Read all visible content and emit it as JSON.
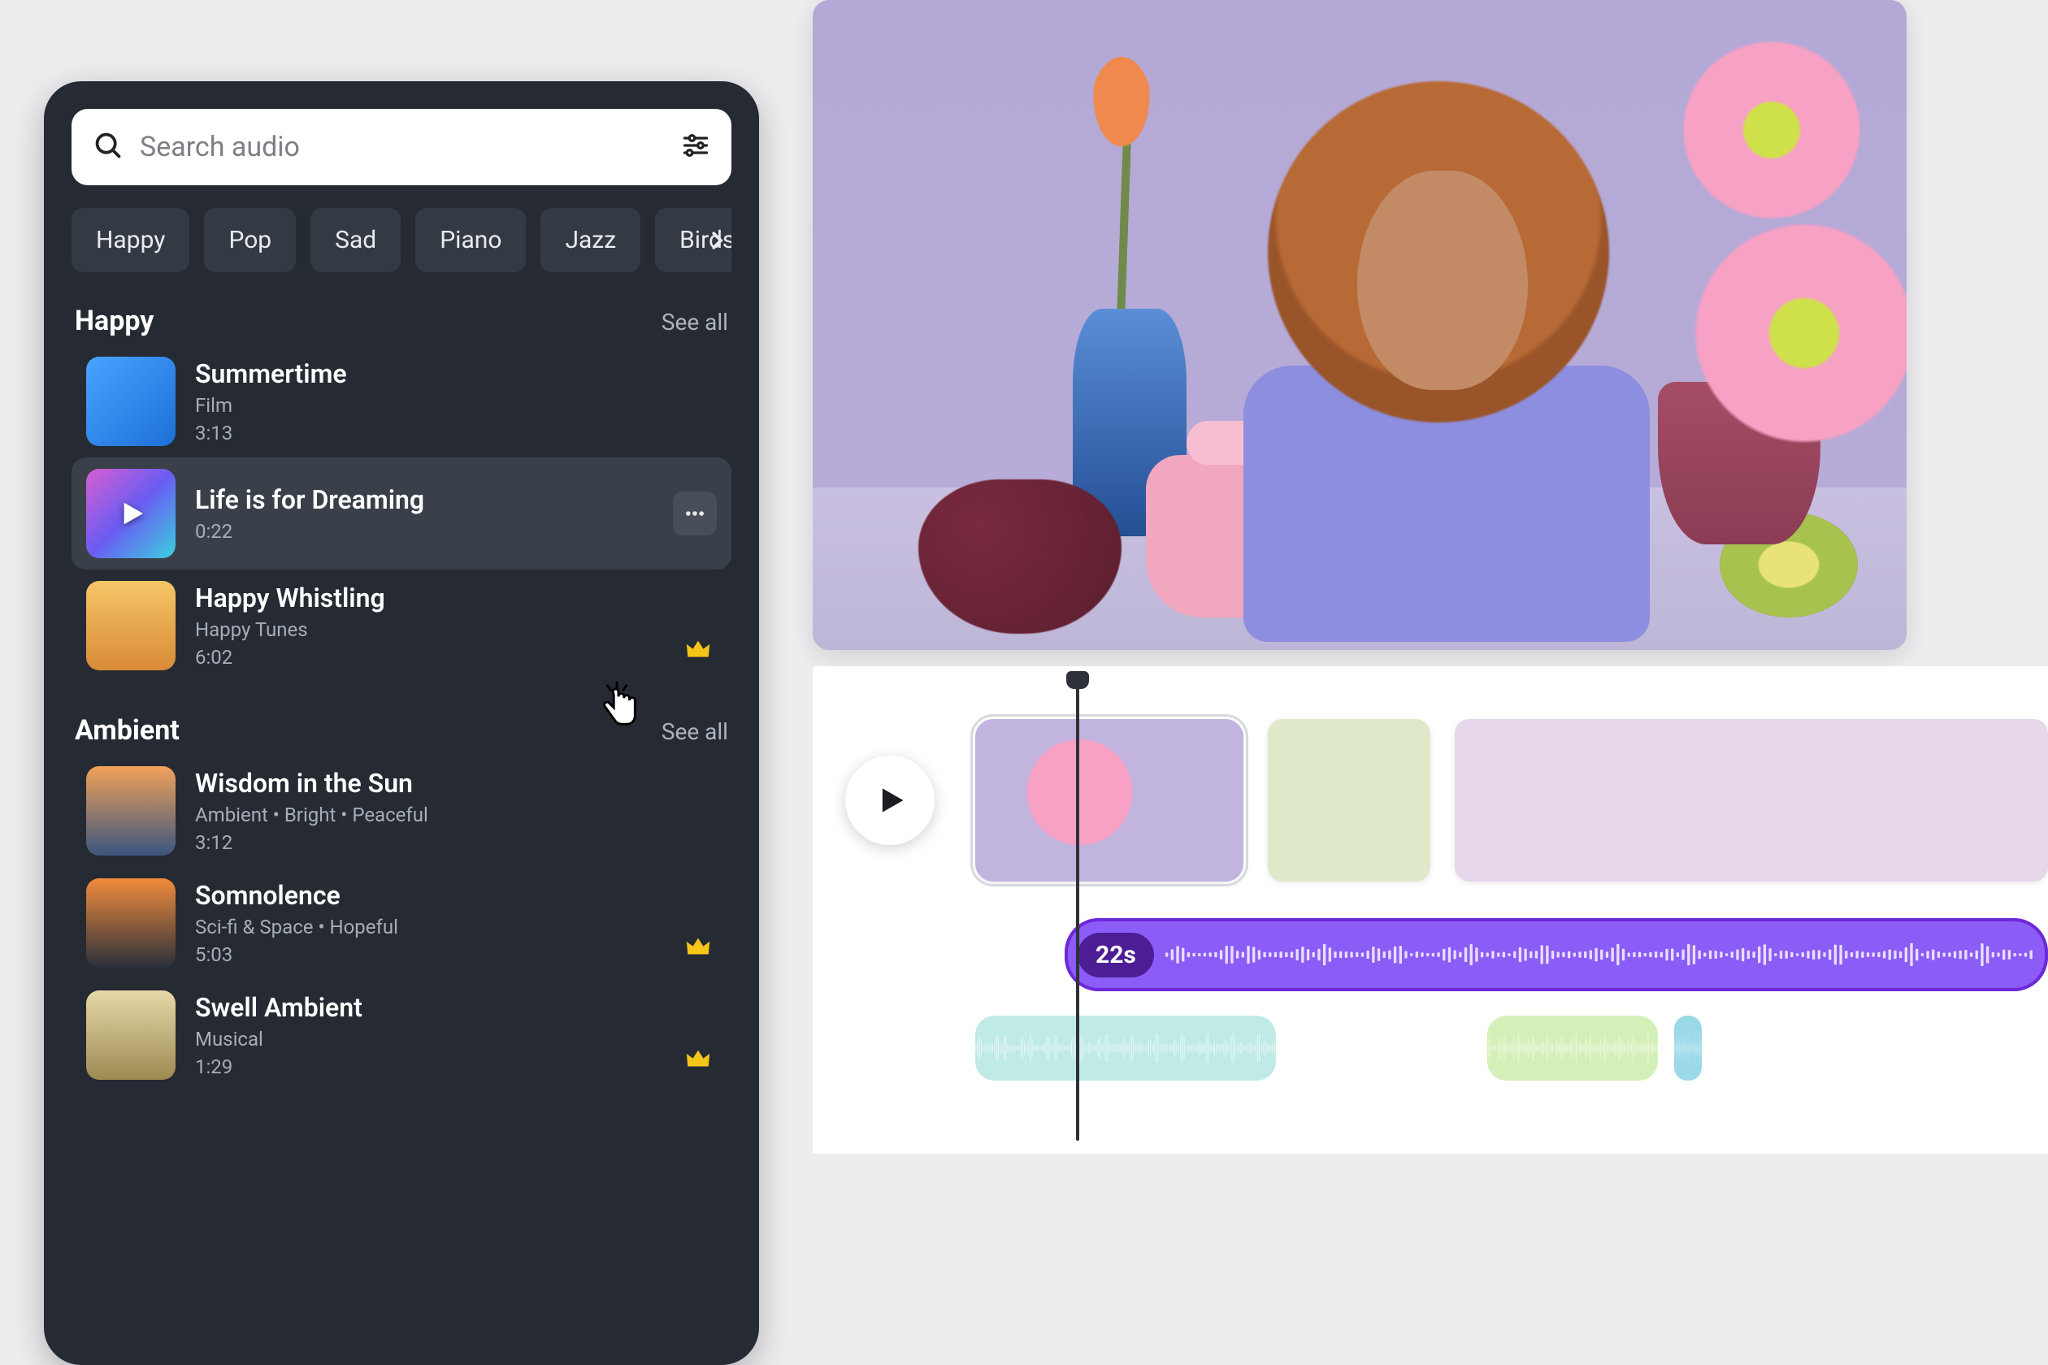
{
  "search": {
    "placeholder": "Search audio"
  },
  "chips": [
    "Happy",
    "Pop",
    "Sad",
    "Piano",
    "Jazz",
    "Birds"
  ],
  "sections": [
    {
      "title": "Happy",
      "see_all": "See all",
      "tracks": [
        {
          "title": "Summertime",
          "sub": "Film",
          "dur": "3:13",
          "premium": false,
          "selected": false
        },
        {
          "title": "Life is for Dreaming",
          "sub": "",
          "dur": "0:22",
          "premium": false,
          "selected": true
        },
        {
          "title": "Happy Whistling",
          "sub": "Happy Tunes",
          "dur": "6:02",
          "premium": true,
          "selected": false
        }
      ]
    },
    {
      "title": "Ambient",
      "see_all": "See all",
      "tracks": [
        {
          "title": "Wisdom in the Sun",
          "sub": "Ambient • Bright • Peaceful",
          "dur": "3:12",
          "premium": false,
          "selected": false
        },
        {
          "title": "Somnolence",
          "sub": "Sci-fi & Space • Hopeful",
          "dur": "5:03",
          "premium": true,
          "selected": false
        },
        {
          "title": "Swell Ambient",
          "sub": "Musical",
          "dur": "1:29",
          "premium": true,
          "selected": false
        }
      ]
    }
  ],
  "timeline": {
    "audio_badge": "22s"
  },
  "thumb_colors": [
    "linear-gradient(135deg,#4aa3ff,#1c6fd6)",
    "linear-gradient(135deg,#d85fd1,#6a5cf2,#3ad1e0)",
    "linear-gradient(180deg,#f5c667,#d98b38)",
    "linear-gradient(180deg,#f2a25a,#3b557e)",
    "linear-gradient(180deg,#f28c3c,#2a2f3a)",
    "linear-gradient(180deg,#e6d8a8,#9c8a52)"
  ]
}
